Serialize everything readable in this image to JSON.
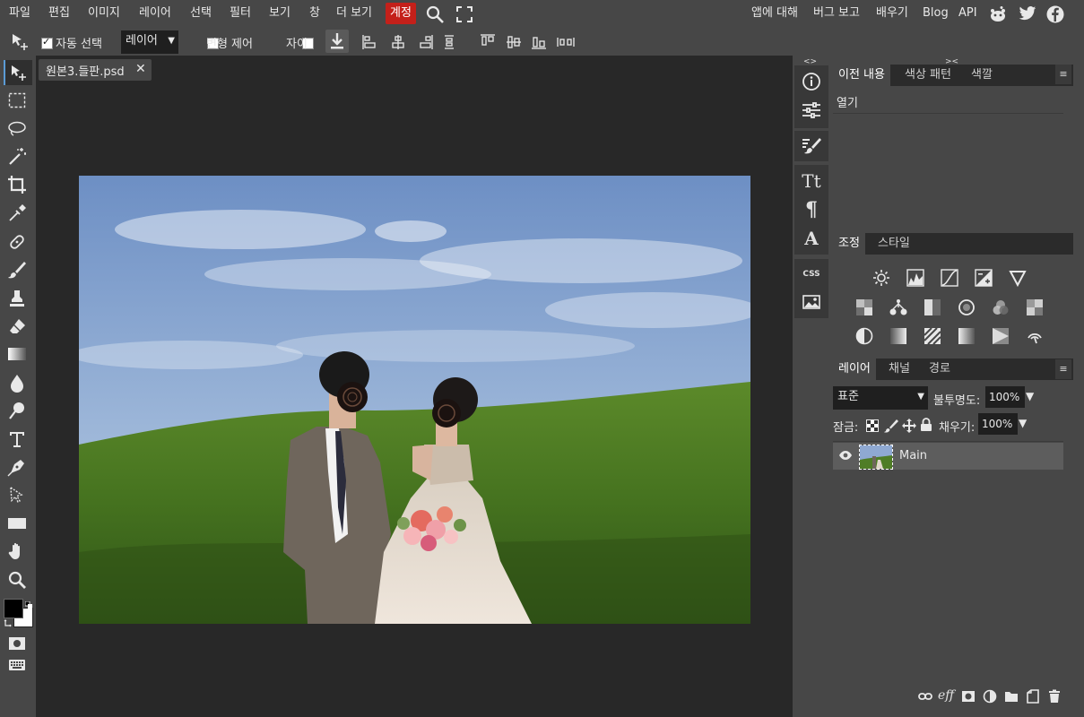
{
  "menu": {
    "items": [
      "파일",
      "편집",
      "이미지",
      "레이어",
      "선택",
      "필터",
      "보기",
      "창",
      "더 보기",
      "계정"
    ],
    "right_links": [
      "앱에 대해",
      "버그 보고",
      "배우기",
      "Blog",
      "API"
    ]
  },
  "options_bar": {
    "auto_select_label": "자동 선택",
    "auto_select_checked": true,
    "target_select": "레이어",
    "transform_label": "변형 제어",
    "distance_label": "자이"
  },
  "document": {
    "tab_title": "원본3.들판.psd"
  },
  "panels": {
    "top_tabs": [
      "이전 내용",
      "색상 패턴",
      "색깔"
    ],
    "history_items": [
      "열기"
    ],
    "adjust_tabs": [
      "조정",
      "스타일"
    ],
    "layer_tabs": [
      "레이어",
      "채널",
      "경로"
    ],
    "blend_mode": "표준",
    "opacity_label": "불투명도:",
    "opacity_value": "100%",
    "lock_label": "잠금:",
    "fill_label": "채우기:",
    "fill_value": "100%",
    "layers": [
      {
        "name": "Main",
        "visible": true
      }
    ],
    "mini_text": {
      "css": "CSS"
    }
  },
  "colors": {
    "accent": "#c4201a",
    "panel_bg": "#474747",
    "workspace_bg": "#282828",
    "selected_tool": "#5b9bd5"
  }
}
